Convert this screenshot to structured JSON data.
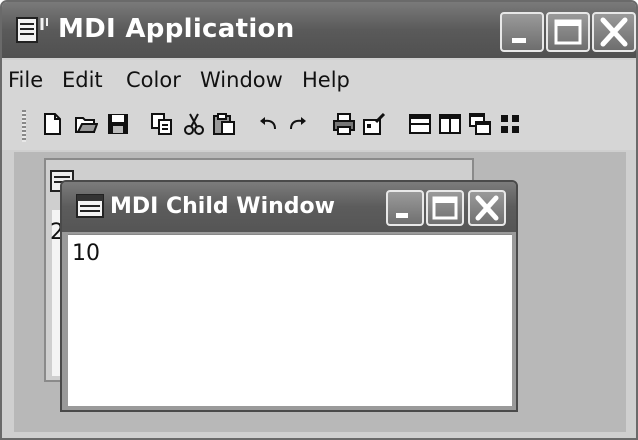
{
  "app": {
    "title": "MDI Application",
    "icon": "mdi-app-icon"
  },
  "titlebar_buttons": [
    "minimize-icon",
    "maximize-icon",
    "close-icon"
  ],
  "menu": {
    "items": [
      "File",
      "Edit",
      "Color",
      "Window",
      "Help"
    ]
  },
  "toolbar": {
    "tools": [
      "new-document-icon",
      "open-folder-icon",
      "save-icon",
      "copy-icon",
      "cut-icon",
      "paste-icon",
      "undo-icon",
      "redo-icon",
      "print-icon",
      "properties-icon",
      "tile-horizontal-icon",
      "tile-vertical-icon",
      "cascade-icon",
      "arrange-icons-icon"
    ]
  },
  "background_child": {
    "value": "2"
  },
  "child_window": {
    "title": "MDI Child Window",
    "value": "10"
  }
}
